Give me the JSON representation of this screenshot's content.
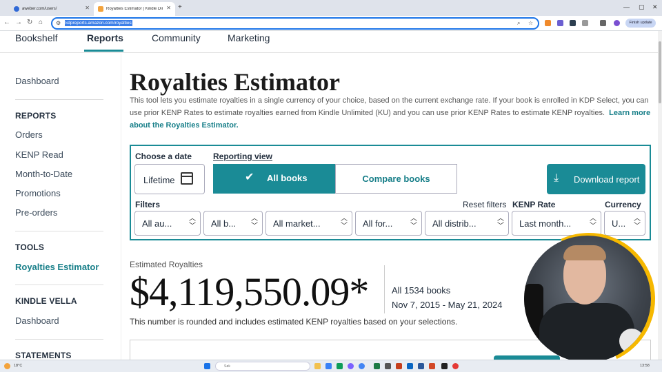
{
  "browser": {
    "tabs": [
      {
        "title": "aweber.com/users/",
        "active": false
      },
      {
        "title": "Royalties Estimator | Kindle Dir...",
        "active": true
      }
    ],
    "url": "kdpreports.amazon.com/royalties",
    "finish_update": "Finish update"
  },
  "topnav": {
    "items": [
      {
        "label": "Bookshelf",
        "active": false
      },
      {
        "label": "Reports",
        "active": true
      },
      {
        "label": "Community",
        "active": false
      },
      {
        "label": "Marketing",
        "active": false
      }
    ]
  },
  "sidebar": {
    "dashboard": "Dashboard",
    "reports_heading": "REPORTS",
    "reports": [
      "Orders",
      "KENP Read",
      "Month-to-Date",
      "Promotions",
      "Pre-orders"
    ],
    "tools_heading": "TOOLS",
    "tools_active": "Royalties Estimator",
    "vella_heading": "KINDLE VELLA",
    "vella_dashboard": "Dashboard",
    "statements_heading": "STATEMENTS"
  },
  "main": {
    "title": "Royalties Estimator",
    "description": "This tool lets you estimate royalties in a single currency of your choice, based on the current exchange rate. If your book is enrolled in KDP Select, you can use prior KENP Rates to estimate royalties earned from Kindle Unlimited (KU) and you can use prior KENP Rates to estimate KENP royalties.",
    "learn_more": "Learn more about the Royalties Estimator."
  },
  "controls": {
    "choose_date_label": "Choose a date",
    "date_value": "Lifetime",
    "reporting_view_label": "Reporting view",
    "view_all": "All books",
    "view_compare": "Compare books",
    "download": "Download report",
    "filters_label": "Filters",
    "reset_filters": "Reset filters",
    "kenp_rate_label": "KENP Rate",
    "currency_label": "Currency",
    "filter_values": [
      "All au...",
      "All b...",
      "All market...",
      "All for...",
      "All distrib..."
    ],
    "kenp_value": "Last month...",
    "currency_value": "U..."
  },
  "results": {
    "label": "Estimated Royalties",
    "amount": "$4,119,550.09*",
    "books": "All 1534 books",
    "range": "Nov 7, 2015 - May 21, 2024",
    "note": "This number is rounded and includes estimated KENP royalties based on your selections."
  },
  "taskbar": {
    "weather": "18°C",
    "search_placeholder": "Søk",
    "time": "13:58"
  },
  "colors": {
    "accent": "#1a8b96",
    "link": "#167e88",
    "webcam_ring": "#f6b800"
  }
}
